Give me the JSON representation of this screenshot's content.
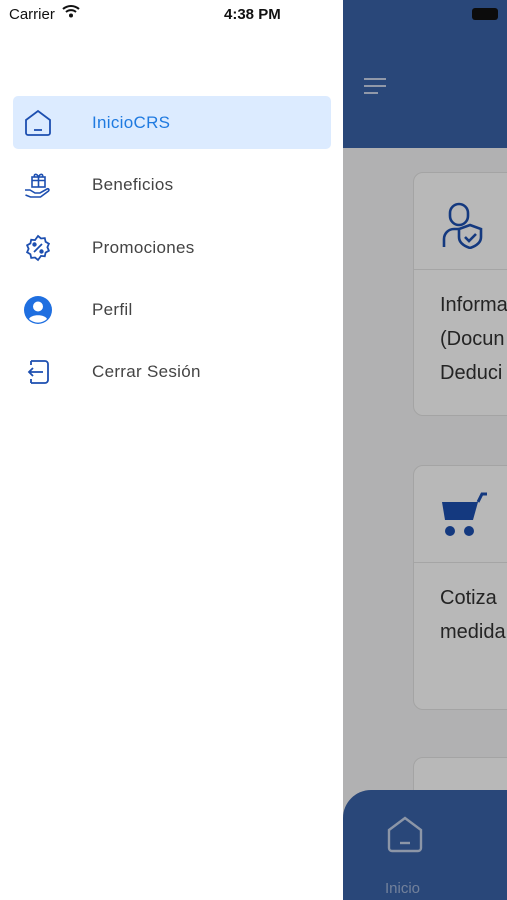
{
  "status_bar": {
    "carrier": "Carrier",
    "time": "4:38 PM"
  },
  "drawer": {
    "items": [
      {
        "label": "InicioCRS",
        "icon": "home-icon",
        "active": true
      },
      {
        "label": "Beneficios",
        "icon": "gift-hand-icon",
        "active": false
      },
      {
        "label": "Promociones",
        "icon": "discount-badge-icon",
        "active": false
      },
      {
        "label": "Perfil",
        "icon": "user-circle-icon",
        "active": false
      },
      {
        "label": "Cerrar Sesión",
        "icon": "logout-icon",
        "active": false
      }
    ]
  },
  "background": {
    "cards": [
      {
        "icon": "user-shield-icon",
        "lines": [
          "Informa",
          "(Docun",
          "Deduci"
        ]
      },
      {
        "icon": "cart-icon",
        "lines": [
          "Cotiza",
          "medida"
        ]
      }
    ],
    "bottom_nav": {
      "label": "Inicio",
      "icon": "home-icon"
    }
  },
  "colors": {
    "primary": "#3a63a8",
    "active_bg": "#dcebff",
    "active_text": "#1f7ae0",
    "icon_blue": "#1d4fb0"
  }
}
